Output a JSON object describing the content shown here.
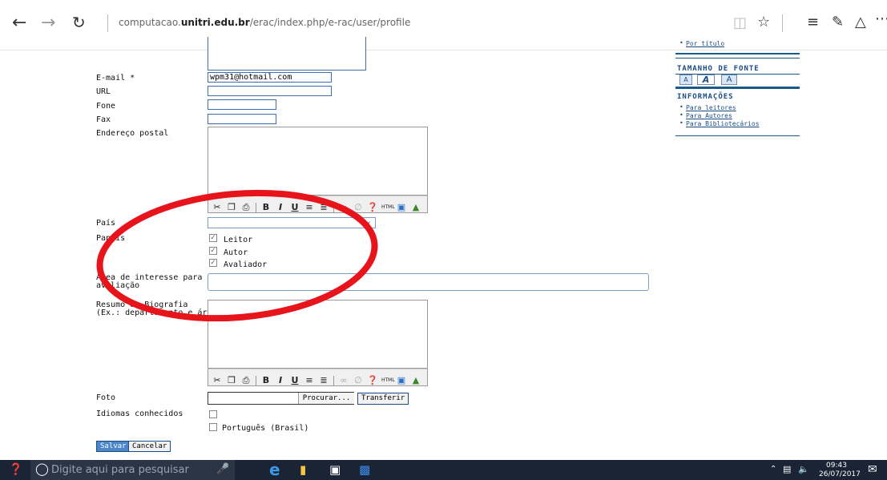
{
  "browser": {
    "url_host_prefix": "computacao.",
    "url_host_bold": "unitri.edu.br",
    "url_path": "/erac/index.php/e-rac/user/profile"
  },
  "form": {
    "email_label": "E-mail *",
    "email_value": "wpm31@hotmail.com",
    "url_label": "URL",
    "phone_label": "Fone",
    "fax_label": "Fax",
    "address_label": "Endereço postal",
    "country_label": "País",
    "roles_label": "Papéis",
    "roles": [
      "Leitor",
      "Autor",
      "Avaliador"
    ],
    "interest_label_1": "Área de interesse para",
    "interest_label_2": "avaliação",
    "bio_label_1": "Resumo da Biografia",
    "bio_label_2": "(Ex.: departamento e área)",
    "photo_label": "Foto",
    "browse_label": "Procurar...",
    "upload_label": "Transferir",
    "languages_label": "Idiomas conhecidos",
    "language_option": "Português (Brasil)",
    "save_label": "Salvar",
    "cancel_label": "Cancelar"
  },
  "sidebar": {
    "by_title_link": "Por título",
    "font_size_title": "TAMANHO DE FONTE",
    "font_small": "A",
    "font_medium": "A",
    "font_large": "A",
    "info_title": "INFORMAÇÕES",
    "info_links": [
      "Para leitores",
      "Para Autores",
      "Para Bibliotecários"
    ]
  },
  "taskbar": {
    "search_placeholder": "Digite aqui para pesquisar",
    "time": "09:43",
    "date": "26/07/2017"
  },
  "colors": {
    "annotation_ring": "#e8141b",
    "link": "#1a4c86",
    "taskbar": "#1b2434"
  }
}
